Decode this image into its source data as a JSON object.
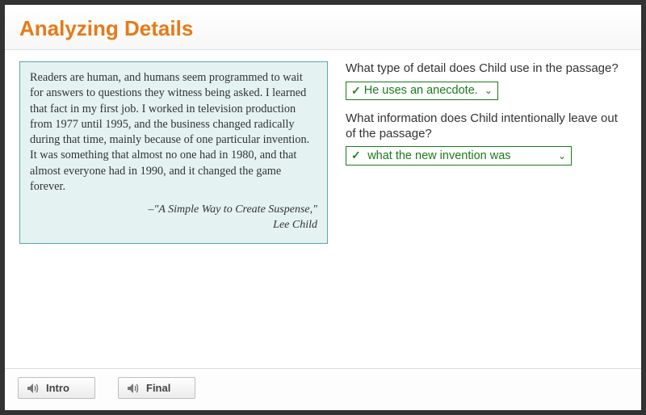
{
  "header": {
    "title": "Analyzing Details"
  },
  "passage": {
    "body": "Readers are human, and humans seem programmed to wait for answers to questions they witness being asked. I learned that fact in my first job. I worked in television production from 1977 until 1995, and the business changed radically during that time, mainly because of one particular invention. It was something that almost no one had in 1980, and that almost everyone had in 1990, and it changed the game forever.",
    "source": "–\"A Simple Way to Create Suspense,\"",
    "author": "Lee Child"
  },
  "questions": {
    "q1": {
      "prompt": "What type of detail does Child use in the passage?",
      "answer": "He uses an anecdote."
    },
    "q2": {
      "prompt": "What information does Child intentionally leave out of the passage?",
      "answer": "what the new invention was"
    }
  },
  "footer": {
    "intro_label": "Intro",
    "final_label": "Final"
  }
}
